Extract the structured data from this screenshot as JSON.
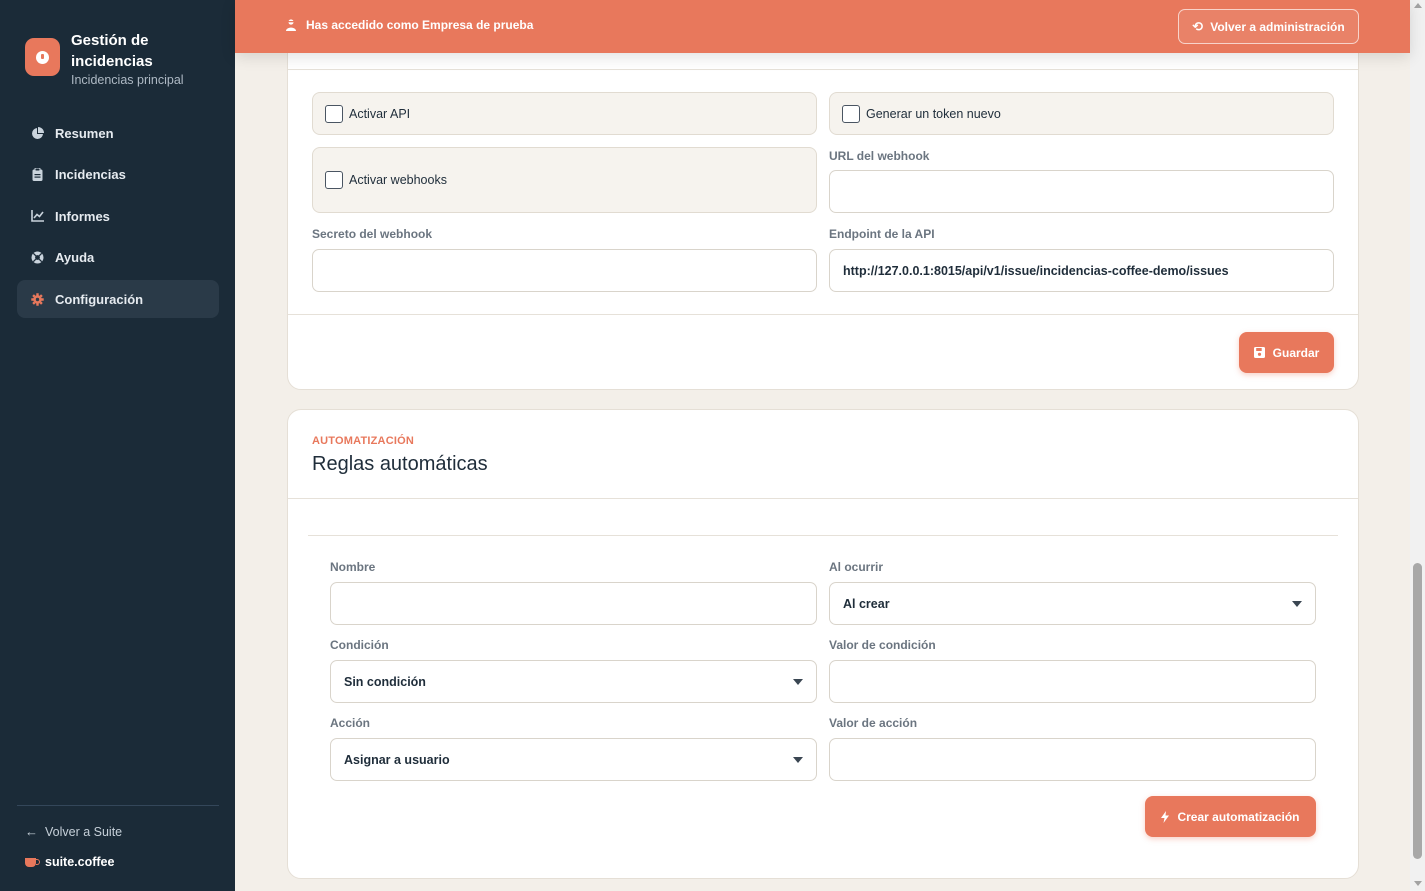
{
  "sidebar": {
    "brand_title": "Gestión de incidencias",
    "brand_subtitle": "Incidencias principal",
    "items": [
      {
        "label": "Resumen",
        "icon": "pie-chart-icon"
      },
      {
        "label": "Incidencias",
        "icon": "clipboard-icon"
      },
      {
        "label": "Informes",
        "icon": "line-chart-icon"
      },
      {
        "label": "Ayuda",
        "icon": "help-icon"
      },
      {
        "label": "Configuración",
        "icon": "gear-icon",
        "active": true
      }
    ],
    "back_label": "Volver a Suite",
    "suite_label": "suite.coffee"
  },
  "banner": {
    "message": "Has accedido como Empresa de prueba",
    "button_label": "Volver a administración"
  },
  "api_card": {
    "activate_api_label": "Activar API",
    "new_token_label": "Generar un token nuevo",
    "activate_webhooks_label": "Activar webhooks",
    "webhook_url_label": "URL del webhook",
    "webhook_url_value": "",
    "webhook_secret_label": "Secreto del webhook",
    "webhook_secret_value": "",
    "endpoint_label": "Endpoint de la API",
    "endpoint_value": "http://127.0.0.1:8015/api/v1/issue/incidencias-coffee-demo/issues",
    "save_label": "Guardar"
  },
  "automation_card": {
    "eyebrow": "AUTOMATIZACIÓN",
    "title": "Reglas automáticas",
    "name_label": "Nombre",
    "name_value": "",
    "trigger_label": "Al ocurrir",
    "trigger_value": "Al crear",
    "condition_label": "Condición",
    "condition_value": "Sin condición",
    "condition_value_label": "Valor de condición",
    "condition_value_value": "",
    "action_label": "Acción",
    "action_value": "Asignar a usuario",
    "action_value_label": "Valor de acción",
    "action_value_value": "",
    "create_label": "Crear automatización"
  },
  "colors": {
    "accent": "#e8785c",
    "sidebar": "#1b2b38",
    "background": "#f3efe9"
  }
}
